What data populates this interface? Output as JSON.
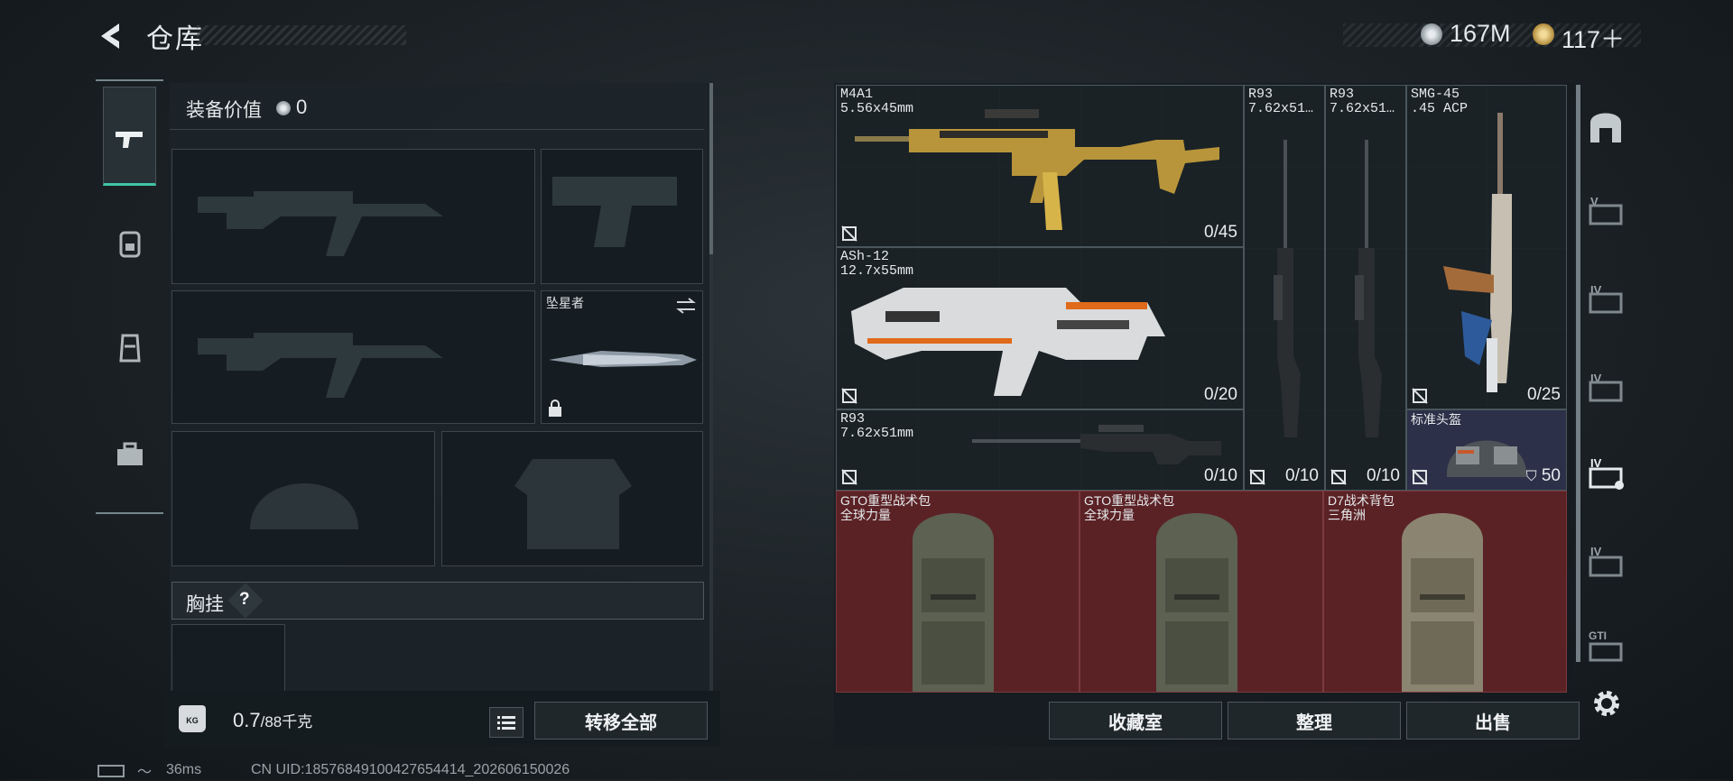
{
  "header": {
    "title": "仓库",
    "currency_1": "167M",
    "currency_2": "117＋",
    "colors": {
      "accent": "#3ec6a6",
      "bag_red": "#5b2226",
      "helmet_bg": "#2c3048"
    }
  },
  "sidebar": {
    "items": [
      {
        "icon": "pistol-icon",
        "selected": true
      },
      {
        "icon": "backpack-icon"
      },
      {
        "icon": "vest-icon"
      },
      {
        "icon": "toolbox-icon"
      }
    ]
  },
  "loadout": {
    "equip_value_label": "装备价值",
    "equip_value": "0",
    "melee_name": "坠星者",
    "chest_label": "胸挂",
    "chest_help": "?",
    "weight": "0.7",
    "weight_max": "/88千克",
    "weight_icon_text": "KG",
    "transfer_all": "转移全部"
  },
  "stash": {
    "items": [
      {
        "name": "M4A1",
        "caliber": "5.56x45mm",
        "count": "0/45"
      },
      {
        "name": "R93",
        "caliber": "7.62x51…",
        "count": "0/10"
      },
      {
        "name": "R93",
        "caliber": "7.62x51…",
        "count": "0/10"
      },
      {
        "name": "SMG-45",
        "caliber": ".45 ACP",
        "count": "0/25"
      },
      {
        "name": "ASh-12",
        "caliber": "12.7x55mm",
        "count": "0/20"
      },
      {
        "name": "R93",
        "caliber": "7.62x51mm",
        "count": "0/10"
      },
      {
        "name": "标准头盔",
        "caliber": "",
        "count": "50"
      }
    ],
    "bags": [
      {
        "name": "GTO重型战术包",
        "sub": "全球力量"
      },
      {
        "name": "GTO重型战术包",
        "sub": "全球力量"
      },
      {
        "name": "D7战术背包",
        "sub": "三角洲"
      }
    ],
    "buttons": {
      "collection": "收藏室",
      "sort": "整理",
      "sell": "出售"
    }
  },
  "right_sidebar": {
    "labels": [
      "",
      "V",
      "IV",
      "IV",
      "IV",
      "IV",
      "GTI"
    ]
  },
  "status_bar": {
    "ping": "36ms",
    "uid": "CN UID:18576849100427654414_202606150026"
  }
}
